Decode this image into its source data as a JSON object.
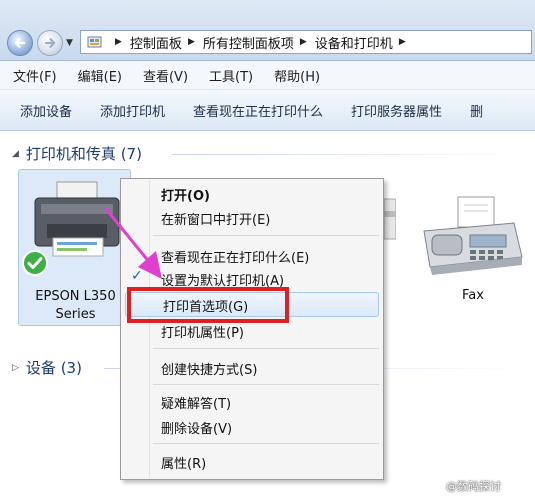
{
  "address": {
    "crumbs": [
      "控制面板",
      "所有控制面板项",
      "设备和打印机"
    ]
  },
  "menu": [
    "文件(F)",
    "编辑(E)",
    "查看(V)",
    "工具(T)",
    "帮助(H)"
  ],
  "commands": [
    "添加设备",
    "添加打印机",
    "查看现在正在打印什么",
    "打印服务器属性",
    "删"
  ],
  "groups": {
    "printers": "打印机和传真 (7)",
    "devices": "设备 (3)"
  },
  "devices": {
    "epson_line1": "EPSON L350",
    "epson_line2": "Series",
    "fax": "Fax"
  },
  "context_menu": {
    "items": [
      "打开(O)",
      "在新窗口中打开(E)",
      "查看现在正在打印什么(E)",
      "设置为默认打印机(A)",
      "打印首选项(G)",
      "打印机属性(P)",
      "创建快捷方式(S)",
      "疑难解答(T)",
      "删除设备(V)",
      "属性(R)"
    ],
    "checked_index": 3,
    "highlighted_index": 4
  },
  "watermark": "@数码探讨",
  "colors": {
    "highlight_box": "#e02020",
    "arrow": "#e040d0",
    "default_badge": "#3cb044"
  }
}
